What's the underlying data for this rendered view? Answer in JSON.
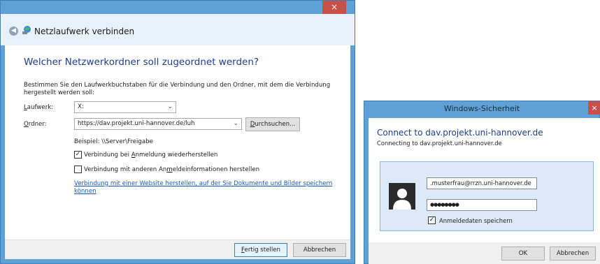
{
  "netzlaufwerk": {
    "window_title": "Netzlaufwerk verbinden",
    "close_glyph": "×",
    "heading": "Welcher Netzwerkordner soll zugeordnet werden?",
    "description": "Bestimmen Sie den Laufwerkbuchstaben für die Verbindung und den Ordner, mit dem die Verbindung hergestellt werden soll:",
    "laufwerk_label_accel": "L",
    "laufwerk_label_rest": "aufwerk:",
    "laufwerk_value": "X:",
    "ordner_label_accel": "O",
    "ordner_label_rest": "rdner:",
    "ordner_value": "https://dav.projekt.uni-hannover.de/luh",
    "browse_button_accel": "D",
    "browse_button_rest": "urchsuchen...",
    "example": "Beispiel: \\\\Server\\Freigabe",
    "reconnect_checkbox_pre": "Verbindung bei ",
    "reconnect_checkbox_accel": "A",
    "reconnect_checkbox_post": "nmeldung wiederherstellen",
    "reconnect_checked": true,
    "other_credentials_pre": "Verbindung mit anderen An",
    "other_credentials_accel": "m",
    "other_credentials_post": "eldeinformationen herstellen",
    "other_credentials_checked": false,
    "website_link": "Verbindung mit einer Website herstellen, auf der Sie Dokumente und Bilder speichern können",
    "finish_button_accel": "F",
    "finish_button_rest": "ertig stellen",
    "cancel_button": "Abbrechen"
  },
  "sicherheit": {
    "window_title": "Windows-Sicherheit",
    "close_glyph": "×",
    "heading": "Connect to dav.projekt.uni-hannover.de",
    "subheading": "Connecting to dav.projekt.uni-hannover.de",
    "username": ".musterfrau@rrzn.uni-hannover.de",
    "password_mask": "●●●●●●●●",
    "save_credentials": "Anmeldedaten speichern",
    "save_checked": true,
    "ok_button": "OK",
    "cancel_button": "Abbrechen"
  },
  "icons": {
    "check": "✓",
    "dropdown": "⌄",
    "back": "◀"
  }
}
